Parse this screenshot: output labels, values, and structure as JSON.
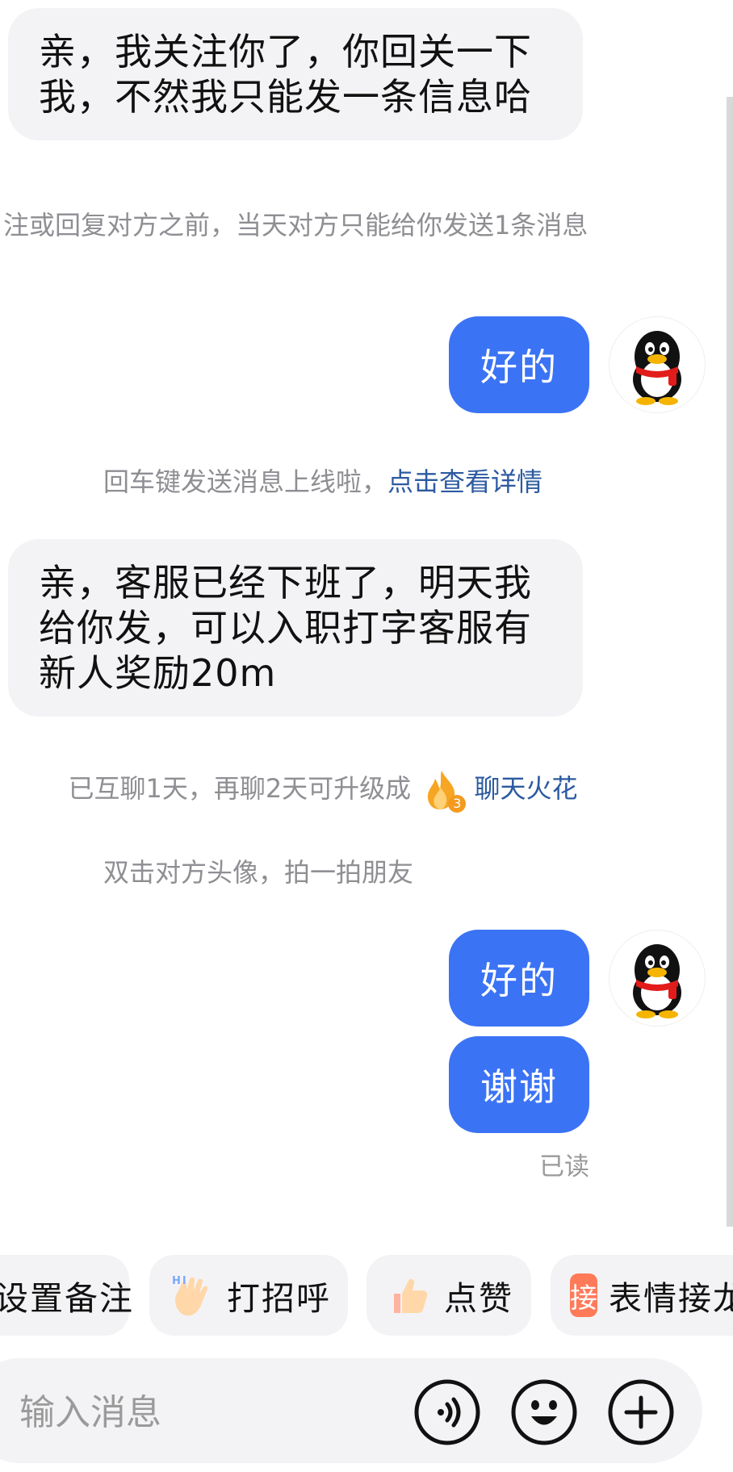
{
  "messages": {
    "m1_text": "亲，我关注你了，你回关一下我，不然我只能发一条信息哈",
    "m2_text": "好的",
    "m3_text": "亲，客服已经下班了，明天我给你发，可以入职打字客服有新人奖励20m",
    "m4_text": "好的",
    "m5_text": "谢谢"
  },
  "system": {
    "notice_follow": "注或回复对方之前，当天对方只能给你发送1条消息",
    "enter_key_notice": "回车键发送消息上线啦，",
    "enter_key_link": "点击查看详情",
    "spark_notice": "已互聊1天，再聊2天可升级成",
    "spark_badge_number": "3",
    "spark_link": "聊天火花",
    "poke_tip": "双击对方头像，拍一拍朋友"
  },
  "read_status": "已读",
  "quick_actions": {
    "remark": "设置备注",
    "greet": "打招呼",
    "like": "点赞",
    "sticker_relay_badge": "接",
    "sticker_relay": "表情接龙"
  },
  "composer": {
    "placeholder": "输入消息"
  },
  "colors": {
    "outgoing_bubble": "#3b73f5",
    "incoming_bubble": "#f3f3f5",
    "link": "#2c5aa0",
    "system_text": "#8e8e93"
  },
  "icons": {
    "avatar": "qq-penguin-icon",
    "spark": "flame-icon",
    "greet": "waving-hand-icon",
    "like": "thumbs-up-icon",
    "voice": "voice-icon",
    "emoji": "emoji-icon",
    "plus": "plus-icon"
  }
}
